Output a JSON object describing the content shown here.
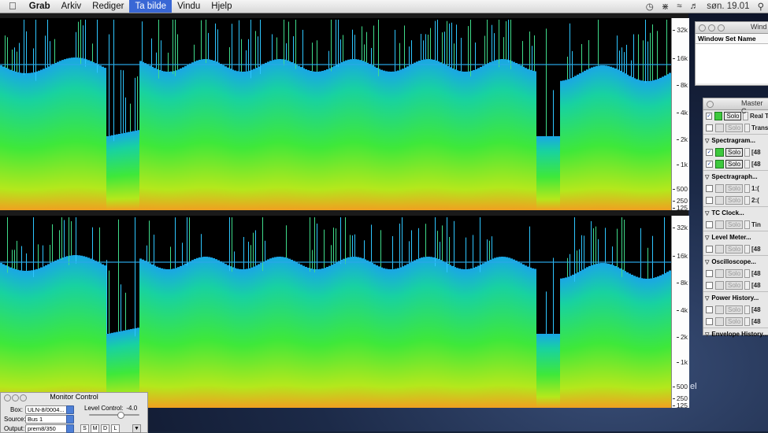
{
  "menubar": {
    "apple_icon": "apple-icon",
    "items": [
      "Grab",
      "Arkiv",
      "Rediger",
      "Ta bilde",
      "Vindu",
      "Hjelp"
    ],
    "active_item": "Ta bilde",
    "clock": "søn. 19.01",
    "status_icons": [
      "time-machine-icon",
      "bluetooth-icon",
      "wifi-icon",
      "volume-icon",
      "spotlight-icon"
    ]
  },
  "spectrogram": {
    "freq_labels": [
      "32k",
      "16k",
      "8k",
      "4k",
      "2k",
      "1k",
      "500",
      "250",
      "125"
    ]
  },
  "window_set_panel": {
    "title": "Wind",
    "column_header": "Window Set Name"
  },
  "master_control": {
    "title": "Master C",
    "top_rows": [
      {
        "checked": true,
        "power_on": true,
        "solo_on": true,
        "label": "Real T"
      },
      {
        "checked": false,
        "power_on": false,
        "solo_on": false,
        "label": "Trans"
      }
    ],
    "groups": [
      {
        "name": "Spectragram...",
        "rows": [
          {
            "checked": true,
            "power_on": true,
            "solo_on": true,
            "label": "[48"
          },
          {
            "checked": true,
            "power_on": true,
            "solo_on": true,
            "label": "[48"
          }
        ]
      },
      {
        "name": "Spectragraph...",
        "rows": [
          {
            "checked": false,
            "power_on": false,
            "solo_on": false,
            "label": "1:("
          },
          {
            "checked": false,
            "power_on": false,
            "solo_on": false,
            "label": "2:("
          }
        ]
      },
      {
        "name": "TC Clock...",
        "rows": [
          {
            "checked": false,
            "power_on": false,
            "solo_on": false,
            "label": "Tin"
          }
        ]
      },
      {
        "name": "Level Meter...",
        "rows": [
          {
            "checked": false,
            "power_on": false,
            "solo_on": false,
            "label": "[48"
          }
        ]
      },
      {
        "name": "Oscilloscope...",
        "rows": [
          {
            "checked": false,
            "power_on": false,
            "solo_on": false,
            "label": "[48"
          },
          {
            "checked": false,
            "power_on": false,
            "solo_on": false,
            "label": "[48"
          }
        ]
      },
      {
        "name": "Power History...",
        "rows": [
          {
            "checked": false,
            "power_on": false,
            "solo_on": false,
            "label": "[48"
          },
          {
            "checked": false,
            "power_on": false,
            "solo_on": false,
            "label": "[48"
          }
        ]
      },
      {
        "name": "Envelope History...",
        "rows": []
      }
    ],
    "solo_label": "Solo"
  },
  "monitor_control": {
    "title": "Monitor Control",
    "box_label": "Box:",
    "box_value": "ULN-8/0004...",
    "level_label": "Level Control:",
    "level_value": "-4.0",
    "source_label": "Source:",
    "source_value": "Bus 1",
    "output_label": "Output:",
    "output_value": "prem8/350",
    "buttons": [
      "S",
      "M",
      "D",
      "L"
    ]
  },
  "desktop_text": "el"
}
